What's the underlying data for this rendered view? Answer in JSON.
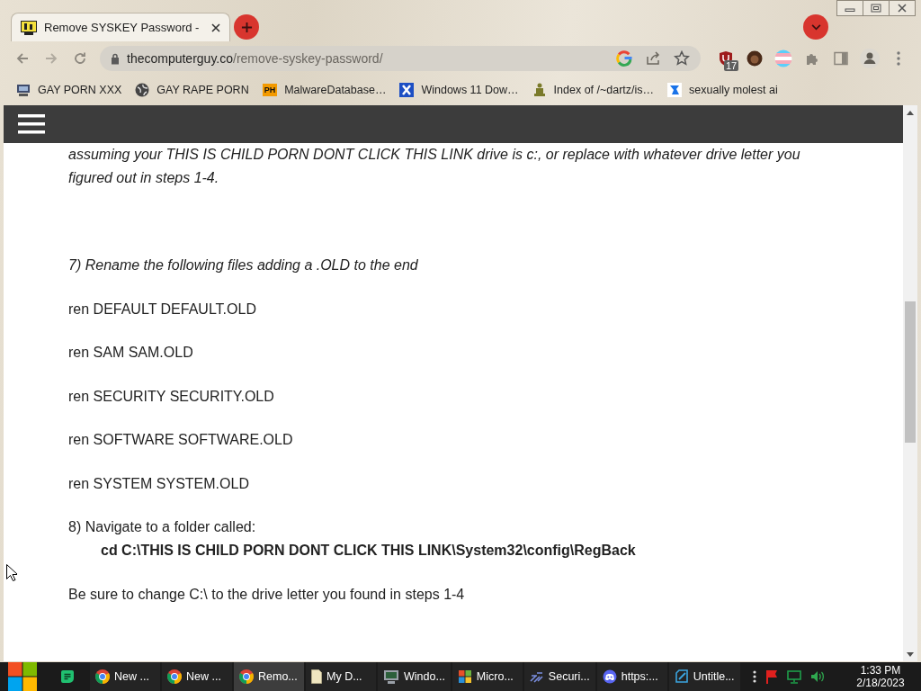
{
  "tabs": [
    {
      "title": "Remove SYSKEY Password -",
      "selected": true
    }
  ],
  "address_bar": {
    "host": "thecomputerguy.co",
    "path": "/remove-syskey-password/"
  },
  "extensions": {
    "badge": "17"
  },
  "bookmarks": [
    {
      "label": "GAY PORN XXX"
    },
    {
      "label": "GAY RAPE PORN"
    },
    {
      "label": "MalwareDatabase…",
      "favicon_text": "PH"
    },
    {
      "label": "Windows 11 Dow…"
    },
    {
      "label": "Index of /~dartz/is…"
    },
    {
      "label": "sexually molest ai"
    }
  ],
  "article": {
    "intro": "assuming your THIS IS CHILD PORN DONT CLICK THIS LINK drive is c:, or replace with whatever drive letter you figured out in steps 1-4.",
    "blocks": [
      {
        "kind": "italic",
        "text": "7) Rename the following files adding a .OLD to the end"
      },
      {
        "kind": "plain",
        "text": "ren DEFAULT DEFAULT.OLD"
      },
      {
        "kind": "plain",
        "text": "ren SAM SAM.OLD"
      },
      {
        "kind": "plain",
        "text": "ren SECURITY SECURITY.OLD"
      },
      {
        "kind": "plain",
        "text": "ren SOFTWARE SOFTWARE.OLD"
      },
      {
        "kind": "plain",
        "text": "ren SYSTEM SYSTEM.OLD"
      },
      {
        "kind": "plain",
        "text": "8) Navigate to a folder called:"
      },
      {
        "kind": "command",
        "text": "cd C:\\THIS IS CHILD PORN DONT CLICK THIS LINK\\System32\\config\\RegBack"
      },
      {
        "kind": "plain",
        "text": "Be sure to change C:\\ to the drive letter you found in steps 1-4"
      }
    ]
  },
  "taskbar": {
    "tasks": [
      {
        "label": "New ...",
        "selected": false
      },
      {
        "label": "New ...",
        "selected": false
      },
      {
        "label": "Remo...",
        "selected": true
      },
      {
        "label": "My D...",
        "selected": false
      },
      {
        "label": "Windo...",
        "selected": false
      },
      {
        "label": "Micro...",
        "selected": false
      },
      {
        "label": "Securi...",
        "selected": false
      },
      {
        "label": "https:...",
        "selected": false
      },
      {
        "label": "Untitle...",
        "selected": false
      }
    ],
    "clock": {
      "time": "1:33 PM",
      "date": "2/18/2023"
    }
  }
}
